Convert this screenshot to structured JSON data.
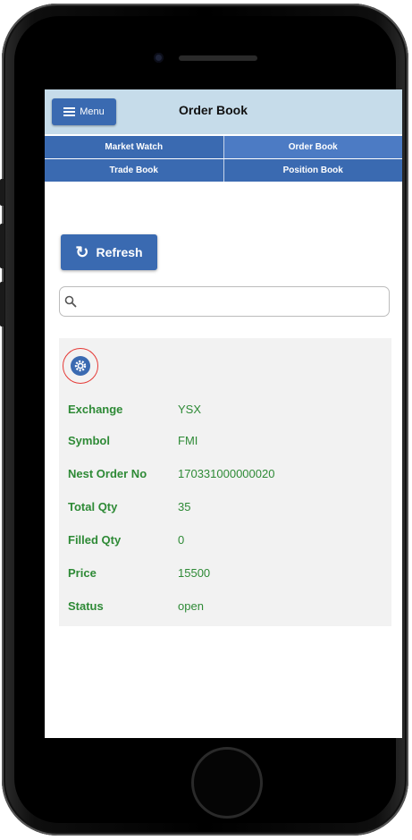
{
  "header": {
    "menu_label": "Menu",
    "title": "Order Book"
  },
  "tabs": [
    {
      "label": "Market Watch",
      "active": false
    },
    {
      "label": "Order Book",
      "active": true
    },
    {
      "label": "Trade Book",
      "active": false
    },
    {
      "label": "Position Book",
      "active": false
    }
  ],
  "toolbar": {
    "refresh_label": "Refresh",
    "refresh_icon": "refresh-icon",
    "search_icon": "search-icon"
  },
  "search": {
    "value": "",
    "placeholder": ""
  },
  "order": {
    "settings_icon": "gear-icon",
    "fields": [
      {
        "label": "Exchange",
        "value": "YSX"
      },
      {
        "label": "Symbol",
        "value": "FMI"
      },
      {
        "label": "Nest Order No",
        "value": "170331000000020"
      },
      {
        "label": "Total Qty",
        "value": "35"
      },
      {
        "label": "Filled Qty",
        "value": "0"
      },
      {
        "label": "Price",
        "value": "15500"
      },
      {
        "label": "Status",
        "value": "open"
      }
    ]
  },
  "colors": {
    "primary_blue": "#3a6ab1",
    "header_bg": "#c6dcea",
    "field_green": "#2e8a36",
    "highlight_red": "#e53935"
  }
}
